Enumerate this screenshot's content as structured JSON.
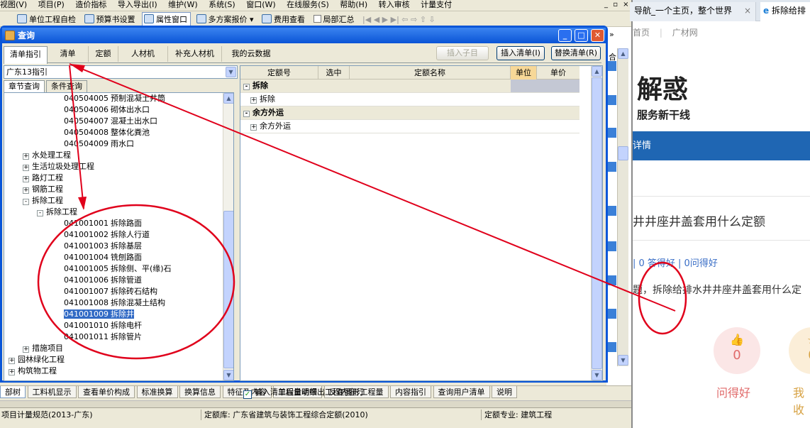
{
  "app": {
    "menubar": [
      "视图(V)",
      "项目(P)",
      "造价指标",
      "导入导出(I)",
      "维护(W)",
      "系统(S)",
      "窗口(W)",
      "在线服务(S)",
      "帮助(H)",
      "转入审核",
      "计量支付"
    ],
    "window_controls": [
      "_",
      "▫",
      "×"
    ],
    "toolbar": {
      "unit_index": "单位工程自检",
      "budget_settings": "预算书设置",
      "property_window": "属性窗口",
      "multi_quote": "多方案报价",
      "fee_view": "费用查看",
      "partial_summary": "局部汇总"
    },
    "bottom_tabs": [
      "工料机显示",
      "查看单价构成",
      "标准换算",
      "换算信息",
      "特征及内容",
      "工程量明细",
      "反查图形工程量",
      "内容指引",
      "查询用户清单",
      "说明"
    ],
    "bottom_left_tab": "部树",
    "status": {
      "spec": "项目计量规范(2013-广东)",
      "quota_lib": "定额库: 广东省建筑与装饰工程综合定额(2010)",
      "quota_major": "定额专业: 建筑工程"
    },
    "accent": "#0a56d8"
  },
  "dialog": {
    "title": "查询",
    "tabs": [
      "清单指引",
      "清单",
      "定额",
      "人材机",
      "补充人材机",
      "我的云数据"
    ],
    "buttons": {
      "insert_child": "插入子目",
      "insert_list": "插入清单(I)",
      "replace_list": "替换清单(R)"
    },
    "library": "广东13指引",
    "subtabs": [
      "章节查询",
      "条件查询"
    ],
    "tree": [
      {
        "code": "040504005",
        "name": "预制混凝土井筒",
        "level": 3
      },
      {
        "code": "040504006",
        "name": "砌体出水口",
        "level": 3
      },
      {
        "code": "040504007",
        "name": "混凝土出水口",
        "level": 3
      },
      {
        "code": "040504008",
        "name": "整体化粪池",
        "level": 3
      },
      {
        "code": "040504009",
        "name": "雨水口",
        "level": 3
      },
      {
        "code": "",
        "name": "水处理工程",
        "level": 1,
        "toggle": "+"
      },
      {
        "code": "",
        "name": "生活垃圾处理工程",
        "level": 1,
        "toggle": "+"
      },
      {
        "code": "",
        "name": "路灯工程",
        "level": 1,
        "toggle": "+"
      },
      {
        "code": "",
        "name": "钢筋工程",
        "level": 1,
        "toggle": "+"
      },
      {
        "code": "",
        "name": "拆除工程",
        "level": 1,
        "toggle": "-"
      },
      {
        "code": "",
        "name": "拆除工程",
        "level": 2,
        "toggle": "-"
      },
      {
        "code": "041001001",
        "name": "拆除路面",
        "level": 3
      },
      {
        "code": "041001002",
        "name": "拆除人行道",
        "level": 3
      },
      {
        "code": "041001003",
        "name": "拆除基层",
        "level": 3
      },
      {
        "code": "041001004",
        "name": "铣刨路面",
        "level": 3
      },
      {
        "code": "041001005",
        "name": "拆除侧、平(缘)石",
        "level": 3
      },
      {
        "code": "041001006",
        "name": "拆除管道",
        "level": 3
      },
      {
        "code": "041001007",
        "name": "拆除砖石结构",
        "level": 3
      },
      {
        "code": "041001008",
        "name": "拆除混凝土结构",
        "level": 3
      },
      {
        "code": "041001009",
        "name": "拆除井",
        "level": 3,
        "selected": true
      },
      {
        "code": "041001010",
        "name": "拆除电杆",
        "level": 3
      },
      {
        "code": "041001011",
        "name": "拆除管片",
        "level": 3
      },
      {
        "code": "",
        "name": "措施项目",
        "level": 1,
        "toggle": "+"
      },
      {
        "code": "",
        "name": "园林绿化工程",
        "level": 0,
        "toggle": "+"
      },
      {
        "code": "",
        "name": "构筑物工程",
        "level": 0,
        "toggle": "+"
      }
    ],
    "grid_headers": [
      "定额号",
      "选中",
      "定额名称",
      "单位",
      "单价"
    ],
    "grid_rows": [
      {
        "text": "拆除",
        "group": true,
        "toggle": "-"
      },
      {
        "text": "拆除",
        "group": false,
        "toggle": "+"
      },
      {
        "text": "余方外运",
        "group": true,
        "toggle": "-"
      },
      {
        "text": "余方外运",
        "group": false,
        "toggle": "+"
      }
    ],
    "auto_option": "输入清单后自动带出工程内容行",
    "auto_option_checked": "✓"
  },
  "browser": {
    "tab1": "导航_一个主页，整个世界",
    "tab2": "拆除给排",
    "tab_close": "×",
    "nav": [
      "首页",
      "广材网"
    ],
    "nav_sep": "|",
    "hero": "解惑",
    "hero_sub": "服务新干线",
    "bluebar": "详情",
    "question": "井井座井盖套用什么定额",
    "stats": "| 0 答得好 | 0问得好",
    "excerpt": "题，拆除给排水井井座井盖套用什么定",
    "like_count": "0",
    "like_label": "问得好",
    "like2_count": "0",
    "like2_label": "我收",
    "thumb_icon": "👍",
    "star_icon": "☆",
    "right_arrow": "»",
    "right_label": "合"
  },
  "annotation_color": "#e0001b"
}
